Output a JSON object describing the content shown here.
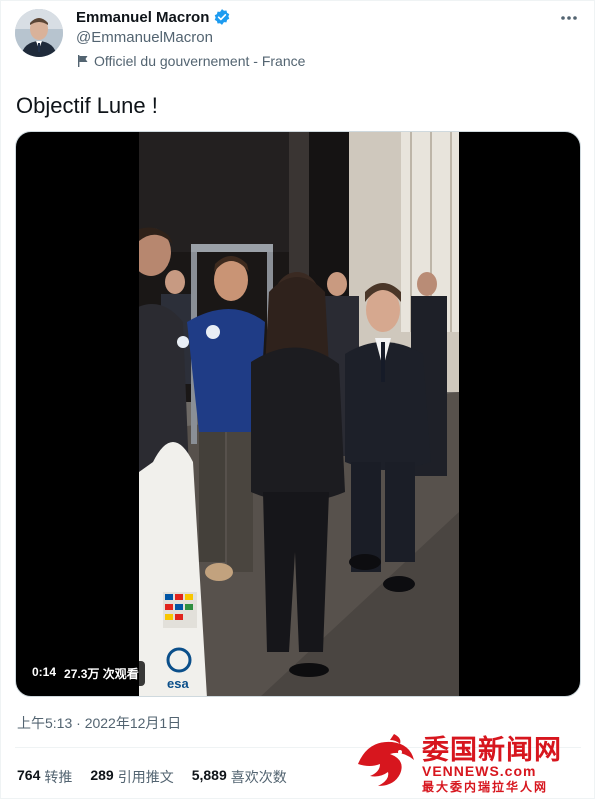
{
  "author": {
    "name": "Emmanuel Macron",
    "handle": "@EmmanuelMacron",
    "label": "Officiel du gouvernement - France",
    "verified_icon": "verified-badge-icon",
    "label_icon": "flag-icon"
  },
  "tweet": {
    "text": "Objectif Lune !",
    "timestamp": "上午5:13 · 2022年12月1日"
  },
  "video": {
    "duration": "0:14",
    "views": "27.3万 次观看",
    "rocket_text": "esa"
  },
  "stats": [
    {
      "value": "764",
      "label": "转推"
    },
    {
      "value": "289",
      "label": "引用推文"
    },
    {
      "value": "5,889",
      "label": "喜欢次数"
    }
  ],
  "watermark": {
    "cn": "委国新闻网",
    "en": "VENNEWS.com",
    "sub": "最大委内瑞拉华人网"
  },
  "colors": {
    "accent": "#1d9bf0",
    "secondary_text": "#536471",
    "watermark": "#d7161e"
  }
}
